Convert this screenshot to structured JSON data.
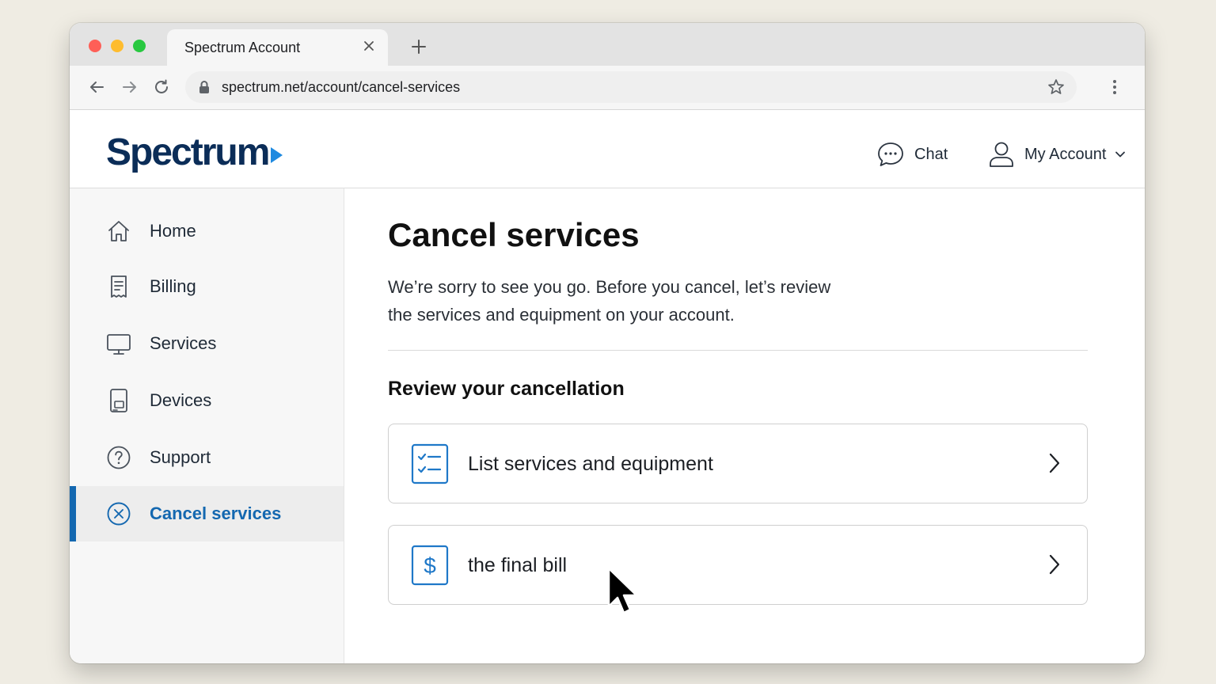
{
  "browser": {
    "tab_title": "Spectrum Account",
    "url": "spectrum.net/account/cancel-services"
  },
  "header": {
    "logo": "Spectrum",
    "chat_label": "Chat",
    "account_label": "My Account"
  },
  "sidebar": {
    "items": [
      {
        "label": "Home",
        "icon": "home-icon"
      },
      {
        "label": "Billing",
        "icon": "receipt-icon"
      },
      {
        "label": "Services",
        "icon": "monitor-icon"
      },
      {
        "label": "Devices",
        "icon": "devices-icon"
      },
      {
        "label": "Support",
        "icon": "help-circle-icon"
      },
      {
        "label": "Cancel services",
        "icon": "cancel-circle-icon",
        "active": true
      }
    ]
  },
  "main": {
    "title": "Cancel services",
    "intro_line1": "We’re sorry to see you go. Before you cancel, let’s review",
    "intro_line2": "the services and equipment on your account.",
    "section_title": "Review your cancellation",
    "cards": [
      {
        "label": "List services and equipment",
        "icon": "checklist-icon"
      },
      {
        "label": "the final bill",
        "icon": "dollar-icon"
      }
    ]
  },
  "colors": {
    "brand_navy": "#0b2d58",
    "brand_blue": "#1f8ae0",
    "active_blue": "#1468b0"
  }
}
